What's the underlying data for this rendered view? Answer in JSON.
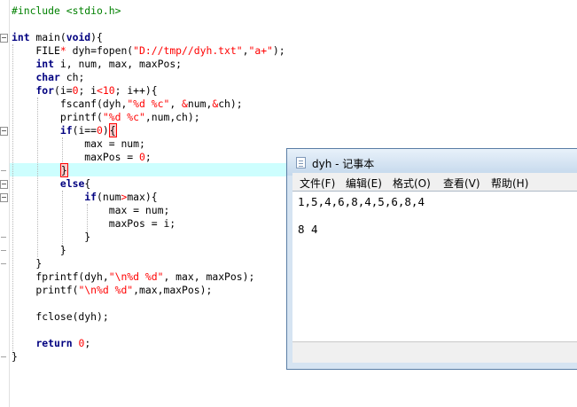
{
  "code": {
    "lines": [
      "#include <stdio.h>",
      "",
      "int main(void){",
      "    FILE* dyh=fopen(\"D://tmp//dyh.txt\",\"a+\");",
      "    int i, num, max, maxPos;",
      "    char ch;",
      "    for(i=0; i<10; i++){",
      "        fscanf(dyh,\"%d %c\", &num,&ch);",
      "        printf(\"%d %c\",num,ch);",
      "        if(i==0){",
      "            max = num;",
      "            maxPos = 0;",
      "        }",
      "        else{",
      "            if(num>max){",
      "                max = num;",
      "                maxPos = i;",
      "            }",
      "        }",
      "    }",
      "    fprintf(dyh,\"\\n%d %d\", max, maxPos);",
      "    printf(\"\\n%d %d\",max,maxPos);",
      "",
      "    fclose(dyh);",
      "",
      "    return 0;",
      "}"
    ]
  },
  "notepad": {
    "title": "dyh - 记事本",
    "menu": [
      "文件(F)",
      "编辑(E)",
      "格式(O)",
      "查看(V)",
      "帮助(H)"
    ],
    "content_line1": "1,5,4,6,8,4,5,6,8,4",
    "content_line2": "8 4"
  },
  "colors": {
    "keyword": "#000080",
    "string": "#ff0000",
    "preprocessor": "#008000",
    "current_line": "#cdfefe",
    "brace_match": "#ff0000"
  },
  "icons": {
    "notepad_title_icon": "notepad-icon",
    "fold_markers": "fold-minus-icon"
  }
}
